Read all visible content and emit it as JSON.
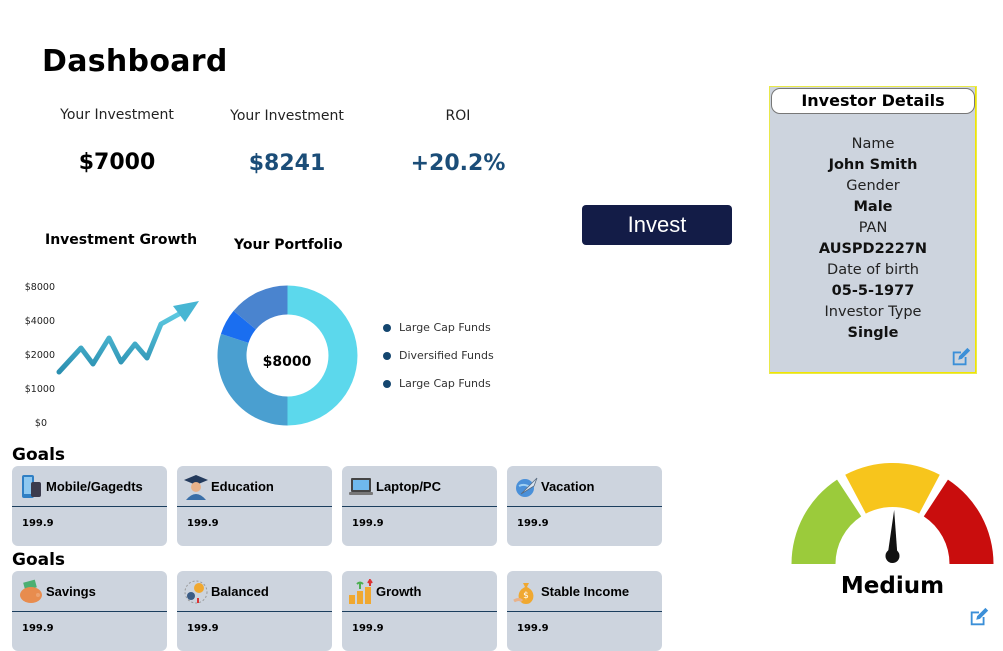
{
  "header": {
    "title": "Dashboard"
  },
  "stats": [
    {
      "label": "Your Investment",
      "value": "$7000"
    },
    {
      "label": "Your Investment",
      "value": "$8241"
    },
    {
      "label": "ROI",
      "value": "+20.2%"
    }
  ],
  "invest_button": "Invest",
  "growth_chart": {
    "title": "Investment Growth",
    "ticks": [
      "$8000",
      "$4000",
      "$2000",
      "$1000",
      "$0"
    ]
  },
  "portfolio": {
    "title": "Your Portfolio",
    "center_label": "$8000",
    "legend": [
      "Large Cap Funds",
      "Diversified Funds",
      "Large Cap Funds"
    ]
  },
  "chart_data": {
    "type": "pie",
    "variant": "donut",
    "title": "Your Portfolio",
    "center_label": "$8000",
    "slices": [
      {
        "value": 50,
        "color": "#5cd8ec"
      },
      {
        "value": 30,
        "color": "#4a9fd0"
      },
      {
        "value": 6,
        "color": "#1a6ef0"
      },
      {
        "value": 14,
        "color": "#4a84cf"
      }
    ]
  },
  "investor": {
    "title": "Investor Details",
    "fields": [
      {
        "label": "Name",
        "value": "John Smith"
      },
      {
        "label": "Gender",
        "value": "Male"
      },
      {
        "label": "PAN",
        "value": "AUSPD2227N"
      },
      {
        "label": "Date of birth",
        "value": "05-5-1977"
      },
      {
        "label": "Investor Type",
        "value": "Single"
      }
    ]
  },
  "goals_sections": [
    {
      "heading": "Goals",
      "cards": [
        {
          "name": "Mobile/Gagedts",
          "amount": "199.9",
          "icon": "mobile-icon"
        },
        {
          "name": "Education",
          "amount": "199.9",
          "icon": "graduate-icon"
        },
        {
          "name": "Laptop/PC",
          "amount": "199.9",
          "icon": "laptop-icon"
        },
        {
          "name": "Vacation",
          "amount": "199.9",
          "icon": "plane-icon"
        }
      ]
    },
    {
      "heading": "Goals",
      "cards": [
        {
          "name": "Savings",
          "amount": "199.9",
          "icon": "wallet-icon"
        },
        {
          "name": "Balanced",
          "amount": "199.9",
          "icon": "coin-icon"
        },
        {
          "name": "Growth",
          "amount": "199.9",
          "icon": "growth-icon"
        },
        {
          "name": "Stable Income",
          "amount": "199.9",
          "icon": "money-bag-icon"
        }
      ]
    }
  ],
  "risk_meter": {
    "label": "Medium",
    "level": 0.5,
    "colors": [
      "#9bcb3b",
      "#f7c51c",
      "#c90d0d"
    ]
  },
  "colors": {
    "accent": "#131c47",
    "card_bg": "#cdd4de",
    "value_blue": "#1b4d78"
  }
}
